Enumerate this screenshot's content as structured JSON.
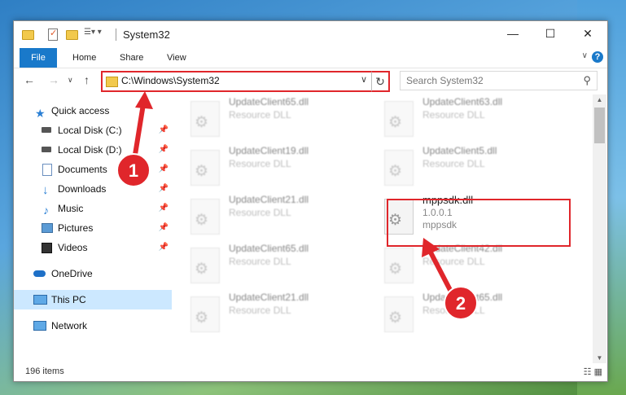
{
  "window": {
    "title": "System32",
    "controls": {
      "minimize": "—",
      "maximize": "☐",
      "close": "✕"
    }
  },
  "ribbon": {
    "tabs": [
      "File",
      "Home",
      "Share",
      "View"
    ],
    "help": "?"
  },
  "navigation": {
    "address": "C:\\Windows\\System32",
    "search_placeholder": "Search System32"
  },
  "sidebar": {
    "items": [
      {
        "label": "Quick access",
        "icon": "star-icon"
      },
      {
        "label": "Local Disk (C:)",
        "icon": "drive-icon"
      },
      {
        "label": "Local Disk (D:)",
        "icon": "drive-icon"
      },
      {
        "label": "Documents",
        "icon": "documents-icon"
      },
      {
        "label": "Downloads",
        "icon": "download-icon"
      },
      {
        "label": "Music",
        "icon": "music-icon"
      },
      {
        "label": "Pictures",
        "icon": "pictures-icon"
      },
      {
        "label": "Videos",
        "icon": "videos-icon"
      },
      {
        "label": "OneDrive",
        "icon": "cloud-icon"
      },
      {
        "label": "This PC",
        "icon": "computer-icon"
      },
      {
        "label": "Network",
        "icon": "network-icon"
      }
    ]
  },
  "files": [
    {
      "name": "UpdateClient65.dll",
      "line2": "Resource DLL"
    },
    {
      "name": "UpdateClient63.dll",
      "line2": "Resource DLL"
    },
    {
      "name": "UpdateClient19.dll",
      "line2": "Resource DLL"
    },
    {
      "name": "UpdateClient5.dll",
      "line2": "Resource DLL"
    },
    {
      "name": "UpdateClient21.dll",
      "line2": "Resource DLL"
    },
    {
      "name": "mppsdk.dll",
      "line2": "1.0.0.1",
      "line3": "mppsdk"
    },
    {
      "name": "UpdateClient65.dll",
      "line2": "Resource DLL"
    },
    {
      "name": "UpdateClient42.dll",
      "line2": "Resource DLL"
    },
    {
      "name": "UpdateClient21.dll",
      "line2": "Resource DLL"
    },
    {
      "name": "UpdateClient65.dll",
      "line2": "Resource DLL"
    }
  ],
  "status": {
    "item_count": "196 items"
  },
  "annotations": {
    "step1": "1",
    "step2": "2",
    "accent": "#e0262b"
  }
}
